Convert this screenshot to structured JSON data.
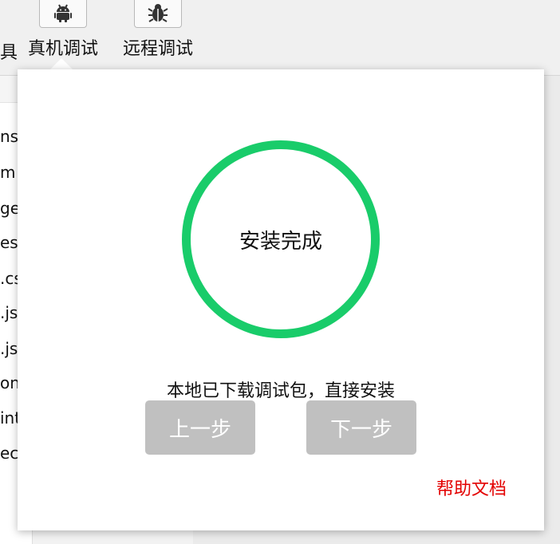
{
  "toolbar": {
    "cut_label": "具",
    "items": [
      {
        "label": "真机调试",
        "icon": "android-icon"
      },
      {
        "label": "远程调试",
        "icon": "bug-icon"
      }
    ]
  },
  "file_list": [
    "ns",
    "m",
    "ge",
    "es",
    ".cs",
    ".js",
    ".js",
    "on",
    "int",
    "ec"
  ],
  "dialog": {
    "status": "安装完成",
    "message": "本地已下载调试包，直接安装",
    "prev_button": "上一步",
    "next_button": "下一步",
    "help_link": "帮助文档",
    "ring_color": "#19cc6a",
    "link_color": "#e30000"
  }
}
